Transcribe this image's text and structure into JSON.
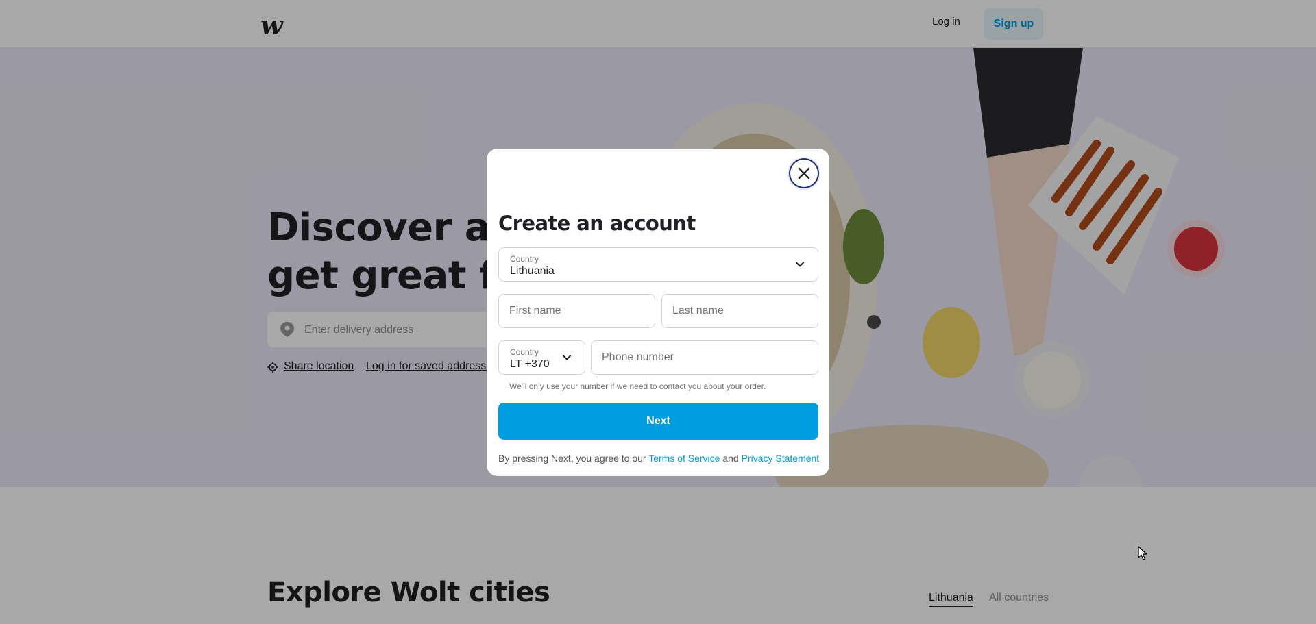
{
  "header": {
    "logo_text": "w",
    "login_label": "Log in",
    "signup_label": "Sign up"
  },
  "hero": {
    "title_line1": "Discover and",
    "title_line2": "get great food",
    "address_placeholder": "Enter delivery address",
    "share_location_label": "Share location",
    "saved_addresses_label": "Log in for saved addresses"
  },
  "explore": {
    "title": "Explore Wolt cities",
    "tabs": [
      {
        "label": "Lithuania",
        "active": true
      },
      {
        "label": "All countries",
        "active": false
      }
    ]
  },
  "modal": {
    "title": "Create an account",
    "country_field": {
      "label": "Country",
      "value": "Lithuania"
    },
    "first_name_placeholder": "First name",
    "last_name_placeholder": "Last name",
    "phone_code_field": {
      "label": "Country",
      "value": "LT +370"
    },
    "phone_placeholder": "Phone number",
    "phone_hint": "We'll only use your number if we need to contact you about your order.",
    "next_label": "Next",
    "terms": {
      "prefix": "By pressing Next, you agree to our ",
      "tos_label": "Terms of Service",
      "and": " and ",
      "privacy_label": "Privacy Statement"
    }
  },
  "icons": {
    "close": "close-icon",
    "chevron": "chevron-down-icon",
    "pin": "location-pin-icon",
    "target": "locate-icon"
  },
  "colors": {
    "brand_blue": "#009de0",
    "signup_bg": "#e5f4fc",
    "text_dark": "#202125",
    "close_ring": "#1b2a78",
    "hero_bg": "#ece9f8"
  }
}
